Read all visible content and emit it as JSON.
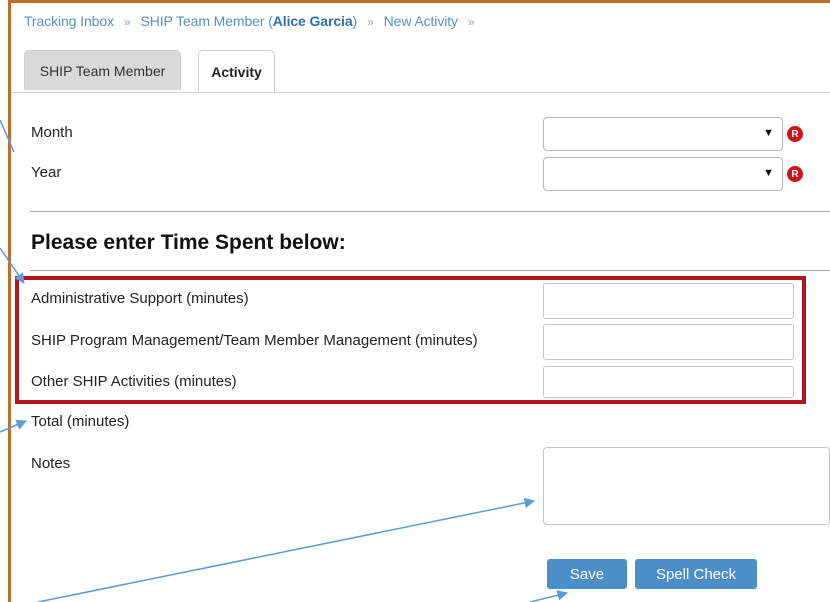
{
  "breadcrumb": {
    "items": [
      "Tracking Inbox",
      "SHIP Team Member (",
      "Alice Garcia",
      ")",
      "New Activity"
    ],
    "separator": "»"
  },
  "tabs": [
    {
      "label": "SHIP Team Member",
      "active": false
    },
    {
      "label": "Activity",
      "active": true
    }
  ],
  "form": {
    "month_label": "Month",
    "month_value": "",
    "year_label": "Year",
    "year_value": "",
    "required_badge": "R",
    "section_heading": "Please enter Time Spent below:",
    "fields": [
      {
        "label": "Administrative Support (minutes)",
        "value": ""
      },
      {
        "label": "SHIP Program Management/Team Member Management (minutes)",
        "value": ""
      },
      {
        "label": "Other SHIP Activities (minutes)",
        "value": ""
      }
    ],
    "total_label": "Total (minutes)",
    "notes_label": "Notes",
    "notes_value": ""
  },
  "buttons": {
    "save": "Save",
    "spell_check": "Spell Check"
  },
  "colors": {
    "accent": "#4a8fc8",
    "highlight_box": "#b3161c",
    "required": "#d0121b",
    "annotation_arrow": "#5b9bd5",
    "frame": "#c46a2a"
  }
}
